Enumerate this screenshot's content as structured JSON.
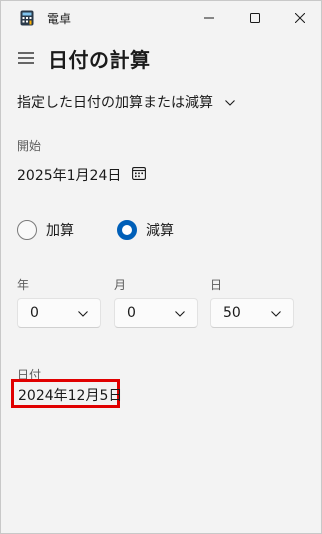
{
  "window": {
    "title": "電卓",
    "icons": {
      "app": "calculator-icon",
      "minimize": "minimize-icon",
      "maximize": "maximize-icon",
      "close": "close-icon"
    }
  },
  "header": {
    "menu_icon": "hamburger-menu-icon",
    "title": "日付の計算"
  },
  "mode": {
    "selected": "指定した日付の加算または減算",
    "chevron_icon": "chevron-down-icon"
  },
  "start": {
    "label": "開始",
    "date": "2025年1月24日",
    "calendar_icon": "calendar-icon"
  },
  "operation": {
    "add_label": "加算",
    "subtract_label": "減算",
    "selected": "減算"
  },
  "fields": {
    "year": {
      "label": "年",
      "value": "0"
    },
    "month": {
      "label": "月",
      "value": "0"
    },
    "day": {
      "label": "日",
      "value": "50"
    }
  },
  "result": {
    "label": "日付",
    "value": "2024年12月5日",
    "highlight_color": "#e00000"
  },
  "colors": {
    "accent": "#005fb8",
    "background": "#f3f3f3"
  }
}
